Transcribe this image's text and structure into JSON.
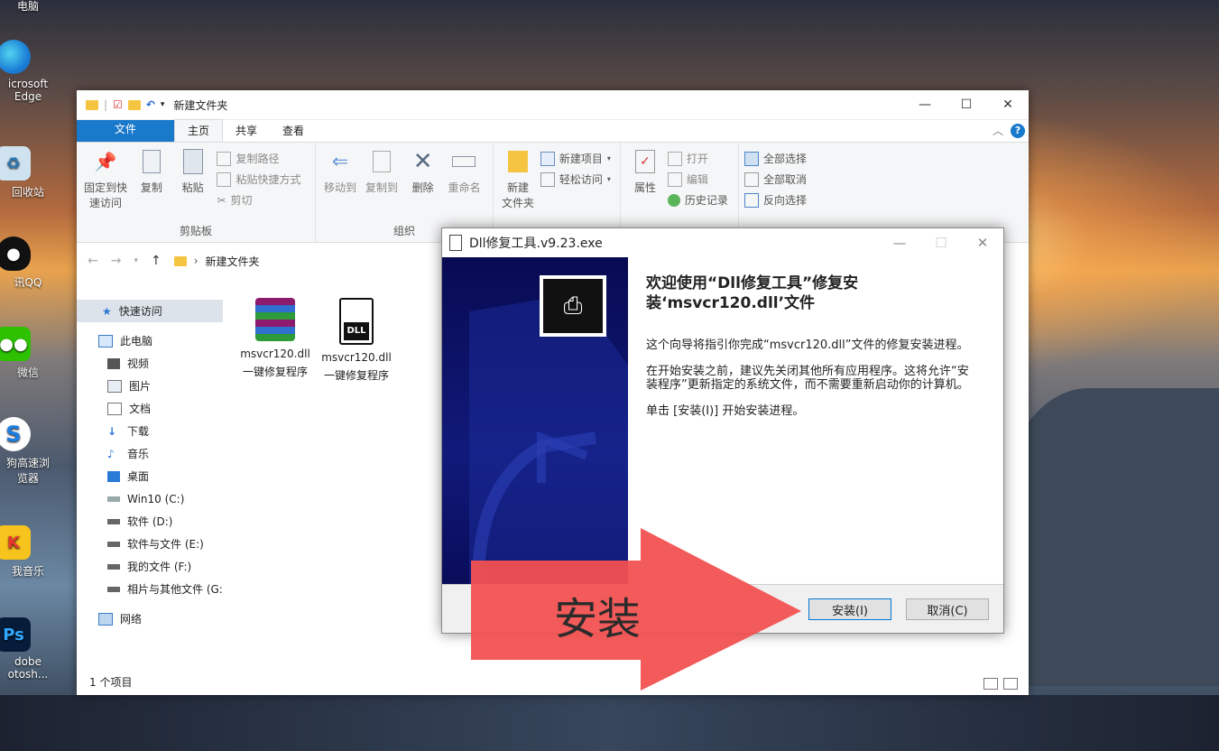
{
  "desktop": {
    "icons": [
      {
        "label": "电脑",
        "icon": "computer-icon"
      },
      {
        "label": "icrosoft\nEdge",
        "icon": "edge-icon"
      },
      {
        "label": "回收站",
        "icon": "recycle-bin-icon"
      },
      {
        "label": "讯QQ",
        "icon": "qq-icon"
      },
      {
        "label": "微信",
        "icon": "wechat-icon"
      },
      {
        "label": "狗高速浏\n览器",
        "icon": "sogou-browser-icon"
      },
      {
        "label": "我音乐",
        "icon": "kuwo-music-icon"
      },
      {
        "label": "dobe\notosh...",
        "icon": "photoshop-icon"
      }
    ]
  },
  "explorer": {
    "title": "新建文件夹",
    "tabs": {
      "file": "文件",
      "home": "主页",
      "share": "共享",
      "view": "查看"
    },
    "ribbon": {
      "pin": "固定到快\n速访问",
      "copy": "复制",
      "paste": "粘贴",
      "copy_path": "复制路径",
      "paste_shortcut": "粘贴快捷方式",
      "cut": "剪切",
      "clipboard_group": "剪贴板",
      "move_to": "移动到",
      "copy_to": "复制到",
      "delete": "删除",
      "rename": "重命名",
      "organize_group": "组织",
      "new_folder": "新建\n文件夹",
      "new_item": "新建项目",
      "easy_access": "轻松访问",
      "properties": "属性",
      "open": "打开",
      "edit": "编辑",
      "history": "历史记录",
      "select_all": "全部选择",
      "select_none": "全部取消",
      "invert_selection": "反向选择"
    },
    "address": {
      "path": "新建文件夹"
    },
    "nav": [
      {
        "label": "快速访问",
        "icon": "star-icon",
        "selected": true
      },
      {
        "label": "此电脑",
        "icon": "pc-icon"
      },
      {
        "label": "视频",
        "icon": "video-icon"
      },
      {
        "label": "图片",
        "icon": "pictures-icon"
      },
      {
        "label": "文档",
        "icon": "documents-icon"
      },
      {
        "label": "下载",
        "icon": "download-icon"
      },
      {
        "label": "音乐",
        "icon": "music-icon"
      },
      {
        "label": "桌面",
        "icon": "desktop-icon"
      },
      {
        "label": "Win10 (C:)",
        "icon": "drive-icon"
      },
      {
        "label": "软件 (D:)",
        "icon": "drive-icon"
      },
      {
        "label": "软件与文件 (E:)",
        "icon": "drive-icon"
      },
      {
        "label": "我的文件 (F:)",
        "icon": "drive-icon"
      },
      {
        "label": "相片与其他文件 (G:",
        "icon": "drive-icon"
      },
      {
        "label": "网络",
        "icon": "network-icon"
      }
    ],
    "files": [
      {
        "line1": "msvcr120.dll",
        "line2": "一键修复程序",
        "icon": "winrar-archive-icon"
      },
      {
        "line1": "msvcr120.dll",
        "line2": "一键修复程序",
        "icon": "dll-file-icon"
      }
    ],
    "status": "1 个项目"
  },
  "dialog": {
    "title": "Dll修复工具.v9.23.exe",
    "heading": "欢迎使用“Dll修复工具”修复安装‘msvcr120.dll’文件",
    "para1": "这个向导将指引你完成“msvcr120.dll”文件的修复安装进程。",
    "para2": "在开始安装之前，建议先关闭其他所有应用程序。这将允许“安装程序”更新指定的系统文件，而不需要重新启动你的计算机。",
    "para3": "单击 [安装(I)] 开始安装进程。",
    "install_btn": "安装(I)",
    "cancel_btn": "取消(C)"
  },
  "overlay": {
    "label": "安装",
    "arrow_color": "#f25151"
  }
}
